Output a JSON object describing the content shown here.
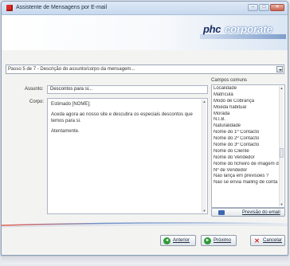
{
  "window": {
    "title": "Assistente de Mensagens por E-mail",
    "controls": [
      "minimize",
      "maximize",
      "close"
    ]
  },
  "banner": {
    "logo_prefix": "phc",
    "logo_suffix": "corporate"
  },
  "step": {
    "selected": "Passo 5 de 7 - Descrição do assunto/corpo da mensagem..."
  },
  "form": {
    "subject_label": "Assunto:",
    "subject_value": "Descontos para si...",
    "body_label": "Corpo:",
    "body_paragraphs": [
      "Estimado [NOME];",
      "Aceda agora ao nosso site e descubra os especiais descontos que temos para si.",
      "Atentamente."
    ]
  },
  "fields": {
    "title": "Campos comuns",
    "items": [
      "Localidade",
      "Matrícula",
      "Modo de Cobrança",
      "Moeda habitual",
      "Morada",
      "N.I.B.",
      "Naturalidade",
      "Nome do 1º Contacto",
      "Nome do 2º Contacto",
      "Nome do 3º Contacto",
      "Nome do Cliente",
      "Nome do Vendedor",
      "Nome do ficheiro de imagem da",
      "Nº de Vendedor",
      "Não lança em previsões ?",
      "Não se envia mailing de conta c"
    ],
    "preview_button": "Previsão do email"
  },
  "buttons": {
    "prev": "Anterior",
    "next": "Próximo",
    "cancel": "Cancelar"
  },
  "icons": {
    "app": "app-icon",
    "dropdown": "chevron-down-icon",
    "preview": "email-preview-icon",
    "prev": "arrow-left-icon",
    "next": "arrow-right-icon",
    "cancel": "close-icon"
  },
  "colors": {
    "accent": "#3c67b0",
    "next_green": "#2f9a3a",
    "cancel_red": "#d12a1c",
    "logo_dark": "#1a2f66"
  }
}
